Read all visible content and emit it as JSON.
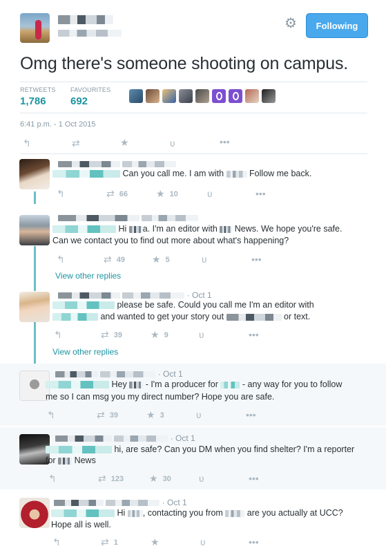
{
  "header": {
    "name": "",
    "handle": "",
    "follow_label": "Following"
  },
  "tweet": {
    "text": "Omg there's someone shooting on campus.",
    "retweets_label": "RETWEETS",
    "retweets": "1,786",
    "favourites_label": "FAVOURITES",
    "favourites": "692",
    "timestamp": "6:41 p.m. - 1 Oct 2015"
  },
  "replies": [
    {
      "date": "",
      "line1": "Can you call me. I am with",
      "line1_tail": "Follow me back.",
      "line2": "",
      "retweets": "66",
      "likes": "10"
    },
    {
      "date": "",
      "line1": "Hi",
      "line1_mid": "a. I'm an editor with",
      "line1_tail": "News. We hope you're safe.",
      "line2": "Can we contact you to find out more about what's happening?",
      "retweets": "49",
      "likes": "5",
      "view_more": "View other replies"
    },
    {
      "date": "· Oct 1",
      "line1": "please be safe.  Could you call me I'm an editor with",
      "line2": "and wanted to get your story out",
      "line2_tail": "or text.",
      "retweets": "39",
      "likes": "9",
      "view_more": "View other replies"
    },
    {
      "date": "· Oct 1",
      "line1": "Hey",
      "line1_mid": "- I'm a producer for",
      "line1_tail": "- any way for you to follow",
      "line2": "me so I can msg you my direct number? Hope you are safe.",
      "retweets": "39",
      "likes": "3"
    },
    {
      "date": "· Oct 1",
      "line1": "hi, are safe?  Can you DM when you find shelter? I'm a reporter",
      "line2": "for",
      "line2_tail": "News",
      "retweets": "123",
      "likes": "30"
    },
    {
      "date": "· Oct 1",
      "line1": "Hi",
      "line1_mid": ", contacting you from",
      "line1_tail": "are you actually at UCC?",
      "line2": "Hope all is well.",
      "retweets": "1",
      "likes": ""
    }
  ],
  "icons": {
    "reply": "reply-arrow-icon",
    "retweet": "retweet-icon",
    "like": "star-icon",
    "vine": "vine-icon",
    "more": "more-dots-icon",
    "settings": "gear-icon"
  },
  "colors": {
    "follow_button": "#4aa8ec",
    "stat_values": "#1c94a0",
    "thread_line": "#6bbfc4",
    "link": "#1c94a0"
  }
}
